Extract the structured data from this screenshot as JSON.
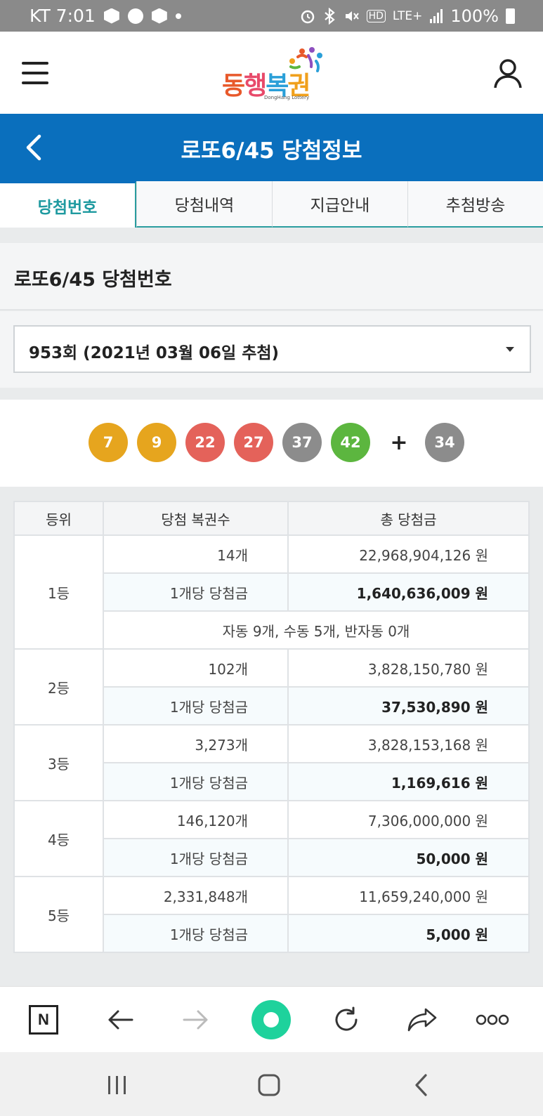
{
  "status_bar": {
    "time": "KT 7:01",
    "network": "LTE+",
    "battery": "100%",
    "icons": [
      "hex-icon",
      "lock-icon",
      "hex-icon",
      "dot-icon",
      "alarm-icon",
      "bluetooth-icon",
      "mute-icon",
      "hd-icon",
      "signal-icon",
      "battery-icon"
    ]
  },
  "header": {
    "logo_text": [
      "동",
      "행",
      "복",
      "권"
    ],
    "logo_sub": "DongHang Lottery",
    "menu_icon": "hamburger-icon",
    "user_icon": "person-icon"
  },
  "titlebar": {
    "title": "로또6/45 당첨정보",
    "back_icon": "chevron-left-icon"
  },
  "tabs": [
    {
      "label": "당첨번호",
      "active": true
    },
    {
      "label": "당첨내역",
      "active": false
    },
    {
      "label": "지급안내",
      "active": false
    },
    {
      "label": "추첨방송",
      "active": false
    }
  ],
  "section_title": "로또6/45 당첨번호",
  "draw_select": {
    "value": "953회 (2021년 03월 06일 추첨)"
  },
  "numbers": {
    "main": [
      {
        "n": "7",
        "color": "#e6a51e"
      },
      {
        "n": "9",
        "color": "#e6a51e"
      },
      {
        "n": "22",
        "color": "#e4625a"
      },
      {
        "n": "27",
        "color": "#e4625a"
      },
      {
        "n": "37",
        "color": "#8c8c8c"
      },
      {
        "n": "42",
        "color": "#5cb63f"
      }
    ],
    "plus": "+",
    "bonus": {
      "n": "34",
      "color": "#8c8c8c"
    }
  },
  "table": {
    "headers": [
      "등위",
      "당첨 복권수",
      "총 당첨금"
    ],
    "rows": [
      {
        "rank": "1등",
        "count": "14개",
        "total": "22,968,904,126 원",
        "per_label": "1개당 당첨금",
        "per_amount": "1,640,636,009 원",
        "note": "자동 9개, 수동 5개, 반자동 0개"
      },
      {
        "rank": "2등",
        "count": "102개",
        "total": "3,828,150,780 원",
        "per_label": "1개당 당첨금",
        "per_amount": "37,530,890 원"
      },
      {
        "rank": "3등",
        "count": "3,273개",
        "total": "3,828,153,168 원",
        "per_label": "1개당 당첨금",
        "per_amount": "1,169,616 원"
      },
      {
        "rank": "4등",
        "count": "146,120개",
        "total": "7,306,000,000 원",
        "per_label": "1개당 당첨금",
        "per_amount": "50,000 원"
      },
      {
        "rank": "5등",
        "count": "2,331,848개",
        "total": "11,659,240,000 원",
        "per_label": "1개당 당첨금",
        "per_amount": "5,000 원"
      }
    ]
  },
  "browser_bar": {
    "n_label": "N",
    "items": [
      "naver-n-icon",
      "back-arrow-icon",
      "forward-arrow-icon",
      "green-dot-icon",
      "refresh-icon",
      "share-icon",
      "more-icon"
    ]
  },
  "nav_bar": {
    "items": [
      "recents-icon",
      "home-icon",
      "back-icon"
    ]
  }
}
